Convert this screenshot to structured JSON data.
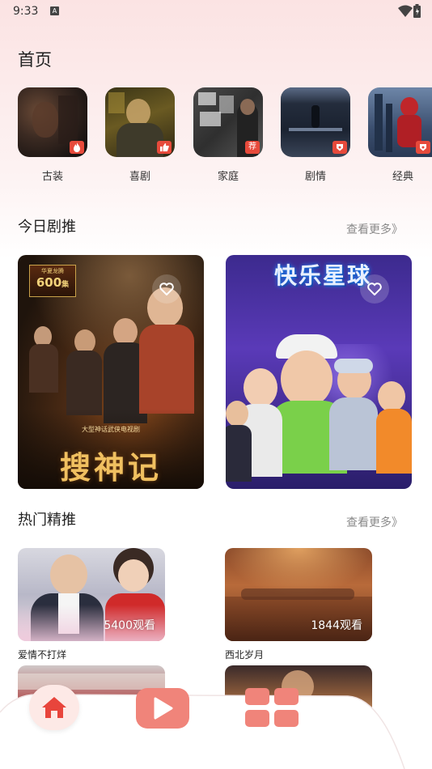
{
  "status_bar": {
    "time": "9:33",
    "indicator": "A"
  },
  "page_title": "首页",
  "categories": [
    {
      "label": "古装",
      "badge_icon": "flame-icon"
    },
    {
      "label": "喜剧",
      "badge_icon": "thumbs-up-icon"
    },
    {
      "label": "家庭",
      "badge": "荐"
    },
    {
      "label": "剧情",
      "badge_icon": "shield-icon"
    },
    {
      "label": "经典",
      "badge_icon": "shield-icon"
    }
  ],
  "today": {
    "title": "今日剧推",
    "more": "查看更多》",
    "posters": [
      {
        "title_art": "搜神记",
        "corner_top": "华夏龙腾",
        "corner_big": "600",
        "corner_sub": "集",
        "tagline": "大型神话武侠电视剧"
      },
      {
        "title_art": "快乐星球"
      }
    ]
  },
  "hot": {
    "title": "热门精推",
    "more": "查看更多》",
    "items": [
      {
        "title": "爱情不打烊",
        "views": "5400观看"
      },
      {
        "title": "西北岁月",
        "views": "1844观看"
      }
    ]
  },
  "colors": {
    "accent": "#e8453c",
    "badge": "#e74a3b",
    "more": "#8a8a8a"
  }
}
